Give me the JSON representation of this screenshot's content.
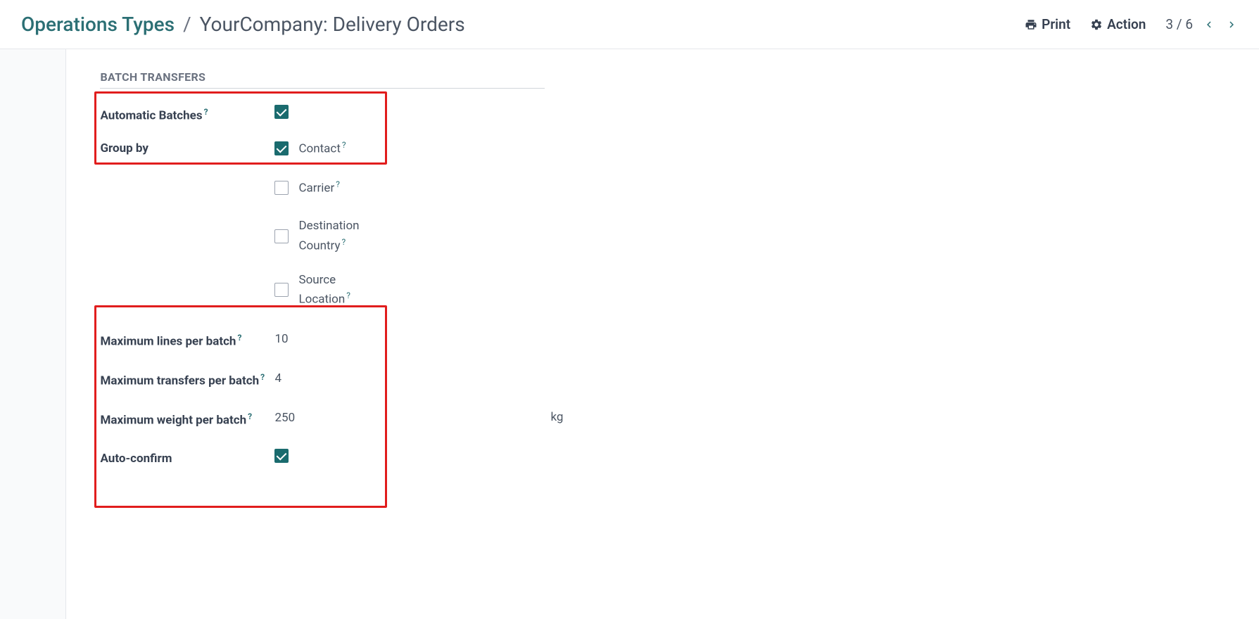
{
  "breadcrumb": {
    "root": "Operations Types",
    "sep": "/",
    "current": "YourCompany: Delivery Orders"
  },
  "actions": {
    "print": "Print",
    "action": "Action"
  },
  "pager": {
    "text": "3 / 6"
  },
  "section": {
    "title": "BATCH TRANSFERS"
  },
  "fields": {
    "automatic_batches": {
      "label": "Automatic Batches",
      "checked": true
    },
    "group_by": {
      "label": "Group by",
      "options": [
        {
          "label": "Contact",
          "checked": true,
          "help": true
        },
        {
          "label": "Carrier",
          "checked": false,
          "help": true
        },
        {
          "label": "Destination Country",
          "checked": false,
          "help": true
        },
        {
          "label": "Source Location",
          "checked": false,
          "help": true
        }
      ]
    },
    "max_lines": {
      "label": "Maximum lines per batch",
      "value": "10"
    },
    "max_transfers": {
      "label": "Maximum transfers per batch",
      "value": "4"
    },
    "max_weight": {
      "label": "Maximum weight per batch",
      "value": "250",
      "unit": "kg"
    },
    "auto_confirm": {
      "label": "Auto-confirm",
      "checked": true
    }
  },
  "help_char": "?"
}
